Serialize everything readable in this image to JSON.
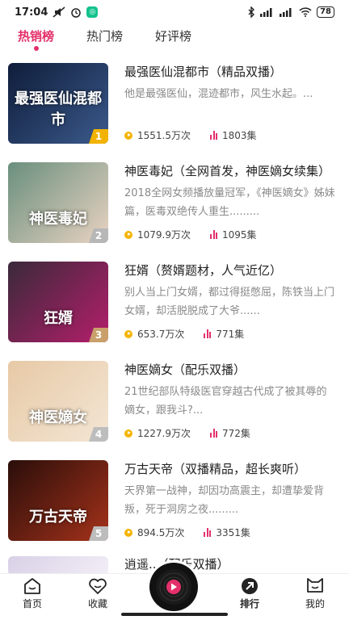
{
  "status_bar": {
    "time": "17:04",
    "battery": "78",
    "app_badge_glyph": "◎"
  },
  "tabs": [
    {
      "label": "热销榜",
      "active": true
    },
    {
      "label": "热门榜",
      "active": false
    },
    {
      "label": "好评榜",
      "active": false
    }
  ],
  "books": [
    {
      "title": "最强医仙混都市（精品双播）",
      "description": "他是最强医仙，混迹都市，风生水起。...",
      "plays": "1551.5万次",
      "episodes": "1803集",
      "rank": "1",
      "cover_text": "最强医仙混都市",
      "cover_colors": [
        "#0f1d3a",
        "#3b5a8c"
      ],
      "badge_color": "#f2b300"
    },
    {
      "title": "神医毒妃（全网首发，神医嫡女续集）",
      "description": "2018全网女频播放量冠军，《神医嫡女》姊妹篇，医毒双绝传人重生.........",
      "plays": "1079.9万次",
      "episodes": "1095集",
      "rank": "2",
      "cover_text": "神医毒妃",
      "cover_colors": [
        "#6a8f7d",
        "#e9d3c2"
      ],
      "badge_color": "#b7b7b7"
    },
    {
      "title": "狂婿（赘婿题材，人气近亿）",
      "description": "别人当上门女婿，都过得挺憋屈，陈铁当上门女婿，却活脱脱成了大爷......",
      "plays": "653.7万次",
      "episodes": "771集",
      "rank": "3",
      "cover_text": "狂婿",
      "cover_colors": [
        "#3a2a3a",
        "#b41e6b"
      ],
      "badge_color": "#c9a06b"
    },
    {
      "title": "神医嫡女（配乐双播）",
      "description": "21世纪部队特级医官穿越古代成了被其辱的嫡女，跟我斗?...",
      "plays": "1227.9万次",
      "episodes": "772集",
      "rank": "4",
      "cover_text": "神医嫡女",
      "cover_colors": [
        "#e7c9a6",
        "#f3e6d4"
      ],
      "badge_color": "#bdbdbd"
    },
    {
      "title": "万古天帝（双播精品，超长爽听）",
      "description": "天界第一战神，却因功高震主，却遭挚爱背叛，死于洞房之夜.........",
      "plays": "894.5万次",
      "episodes": "3351集",
      "rank": "5",
      "cover_text": "万古天帝",
      "cover_colors": [
        "#2a0e0a",
        "#a5321a"
      ],
      "badge_color": "#bdbdbd"
    }
  ],
  "partial_book": {
    "title": "逍遥..（配乐双播）",
    "cover_colors": [
      "#d9d0e6",
      "#f2eef7"
    ]
  },
  "bottom_nav": [
    {
      "label": "首页",
      "icon": "home-icon"
    },
    {
      "label": "收藏",
      "icon": "heart-icon"
    },
    {
      "label": "排行",
      "icon": "ranking-icon"
    },
    {
      "label": "我的",
      "icon": "profile-icon"
    }
  ],
  "colors": {
    "accent": "#e4306b",
    "play_icon": "#f5b400",
    "muted_text": "#8a8a8a"
  }
}
